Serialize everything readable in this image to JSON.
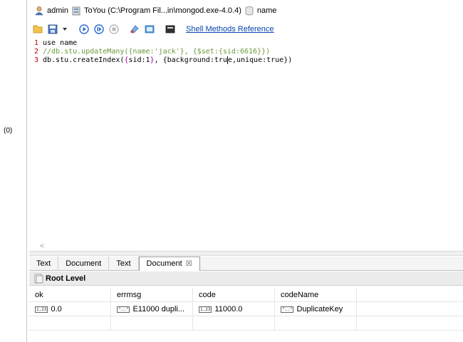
{
  "left_panel": {
    "count": "(0)"
  },
  "connection": {
    "user": "admin",
    "server": "ToYou (C:\\Program Fil...in\\mongod.exe-4.0.4)",
    "database": "name"
  },
  "toolbar": {
    "shell_link": "Shell Methods Reference"
  },
  "editor": {
    "lines": [
      {
        "num": "1",
        "text": "use name"
      },
      {
        "num": "2",
        "text": "//db.stu.updateMany({name:'jack'}, {$set:{sid:6616}})"
      },
      {
        "num": "3",
        "pre": "db.stu.createIndex(",
        "b1": "{",
        "mid": "sid:1",
        "b2": "}",
        "mid2": ", {background:tru",
        "post": "e,unique:true})"
      }
    ],
    "scroll_arrow": "<"
  },
  "result_tabs": [
    {
      "label": "Text",
      "active": false
    },
    {
      "label": "Document",
      "active": false
    },
    {
      "label": "Text",
      "active": false
    },
    {
      "label": "Document",
      "active": true,
      "close": "☒"
    }
  ],
  "root_level": {
    "label": "Root Level"
  },
  "grid": {
    "columns": [
      "ok",
      "errmsg",
      "code",
      "codeName"
    ],
    "rows": [
      [
        {
          "type_badge": "1.23",
          "value": "0.0"
        },
        {
          "type_badge": "\"..\"",
          "value": "E11000 dupli..."
        },
        {
          "type_badge": "1.23",
          "value": "11000.0"
        },
        {
          "type_badge": "\"..\"",
          "value": "DuplicateKey"
        }
      ]
    ]
  }
}
